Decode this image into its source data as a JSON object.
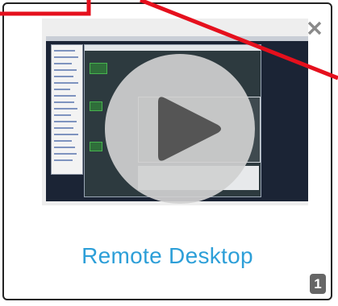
{
  "card": {
    "title": "Remote Desktop",
    "count_badge": "1",
    "close_icon": "close-icon",
    "play_icon": "play-icon"
  },
  "colors": {
    "title": "#2d9fd8",
    "badge_bg": "#666666",
    "card_border": "#222222",
    "annotation": "#e5101d"
  }
}
